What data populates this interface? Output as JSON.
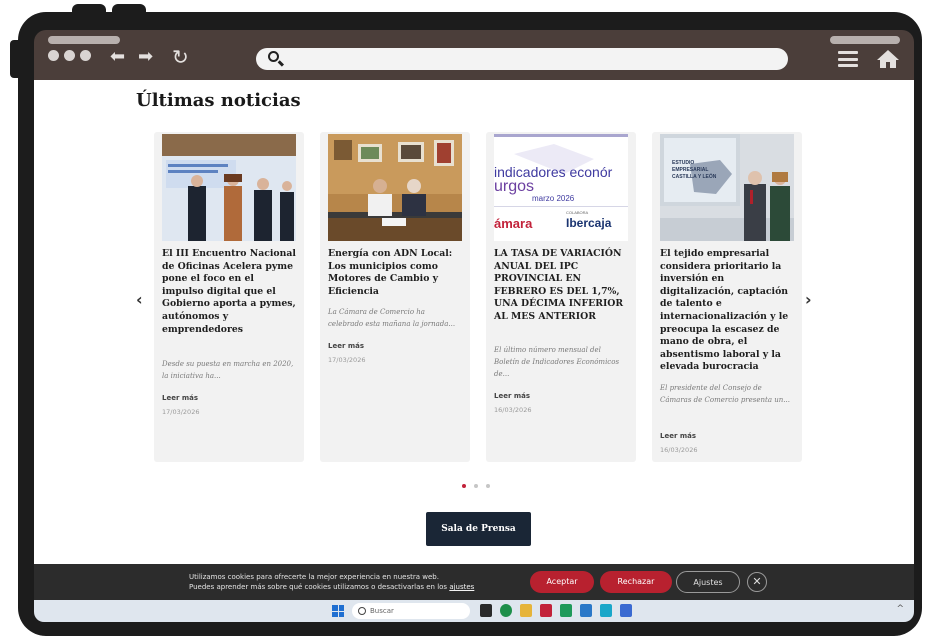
{
  "browser": {
    "address_value": ""
  },
  "page": {
    "section_title": "Últimas noticias",
    "prev_arrow": "‹",
    "next_arrow": "›",
    "news": [
      {
        "title": "El III Encuentro Nacional de Oficinas Acelera pyme pone el foco en el impulso digital que el Gobierno aporta a pymes, autónomos y emprendedores",
        "excerpt": "Desde su puesta en marcha en 2020, la iniciativa ha...",
        "read_more": "Leer más",
        "date": "17/03/2026"
      },
      {
        "title": "Energía con ADN Local: Los municipios como Motores de Cambio y Eficiencia",
        "excerpt": "La Cámara de Comercio ha celebrado esta mañana la jornada...",
        "read_more": "Leer más",
        "date": "17/03/2026"
      },
      {
        "title": "LA TASA DE VARIACIÓN ANUAL DEL IPC PROVINCIAL EN FEBRERO ES DEL 1,7%, UNA DÉCIMA INFERIOR AL MES ANTERIOR",
        "excerpt": "El último número mensual del Boletín de Indicadores Económicos de...",
        "read_more": "Leer más",
        "date": "16/03/2026",
        "image_text": {
          "line1": "indicadores econór",
          "line2": "urgos",
          "line3": "marzo 2026",
          "brand1": "ámara",
          "brand2_small": "COLABORA",
          "brand2": "Ibercaja"
        }
      },
      {
        "title": "El tejido empresarial considera prioritario la inversión en digitalización, captación de talento e internacionalización y le preocupa la escasez de mano de obra, el absentismo laboral y la elevada burocracia",
        "excerpt": "El presidente del Consejo de Cámaras de Comercio presenta un...",
        "read_more": "Leer más",
        "date": "16/03/2026",
        "image_text": {
          "screen_line1": "ESTUDIO",
          "screen_line2": "EMPRESARIAL",
          "screen_line3": "CASTILLA Y LEÓN"
        }
      }
    ],
    "press_button": "Sala de Prensa"
  },
  "cookies": {
    "line1": "Utilizamos cookies para ofrecerte la mejor experiencia en nuestra web.",
    "line2": "Puedes aprender más sobre qué cookies utilizamos o desactivarlas en los",
    "link": "ajustes",
    "accept": "Aceptar",
    "reject": "Rechazar",
    "settings": "Ajustes",
    "close": "✕"
  },
  "taskbar": {
    "search_placeholder": "Buscar",
    "tray_chevron": "^"
  },
  "colors": {
    "chrome": "#4b3e3a",
    "accent_red": "#b8212f",
    "press_button_bg": "#1a2636"
  }
}
